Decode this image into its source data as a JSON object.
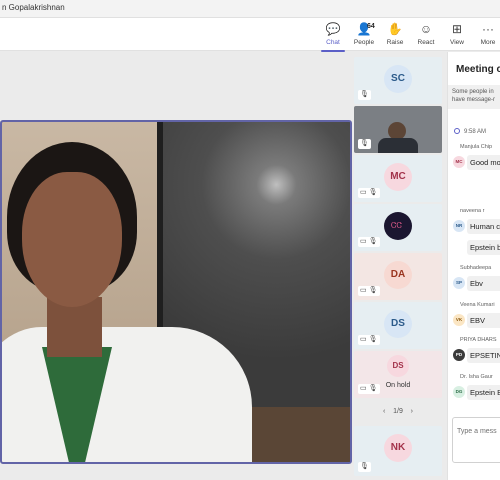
{
  "window": {
    "title": "n Gopalakrishnan"
  },
  "toolbar": {
    "buttons": [
      {
        "label": "Chat",
        "icon": "chat-icon",
        "glyph": "💬"
      },
      {
        "label": "People",
        "icon": "people-icon",
        "glyph": "👤",
        "count": "64"
      },
      {
        "label": "Raise",
        "icon": "raise-hand-icon",
        "glyph": "✋"
      },
      {
        "label": "React",
        "icon": "react-icon",
        "glyph": "☺"
      },
      {
        "label": "View",
        "icon": "view-icon",
        "glyph": "⊞"
      },
      {
        "label": "More",
        "icon": "more-icon",
        "glyph": "···"
      }
    ]
  },
  "thumbnails": [
    {
      "initials": "SC",
      "color": "#d8e6f5",
      "text_color": "#2b5a8a"
    },
    {
      "initials": "",
      "video": true
    },
    {
      "initials": "MC",
      "color": "#f7d8df",
      "text_color": "#a3334b"
    },
    {
      "initials": "",
      "logo": true
    },
    {
      "initials": "DA",
      "color": "#f7d9d2",
      "text_color": "#9a3520"
    },
    {
      "initials": "DS",
      "color": "#d8e6f5",
      "text_color": "#2b5a8a"
    },
    {
      "initials": "DS",
      "color": "#f7d8df",
      "text_color": "#a3334b",
      "status": "On hold"
    },
    {
      "initials": "NK",
      "color": "#f7d8df",
      "text_color": "#a3334b"
    }
  ],
  "pager": {
    "text": "1/9",
    "prev": "‹",
    "next": "›"
  },
  "chat": {
    "title": "Meeting c",
    "banner": [
      "Some people in",
      "have message-r"
    ],
    "time": "9:58 AM",
    "messages": [
      {
        "sender": "Manjula Chip",
        "initials": "MC",
        "text": "Good mo",
        "color": "#f7d8df",
        "tc": "#a3334b"
      },
      {
        "sender": "naveena r",
        "initials": "NR",
        "text": "Human c",
        "color": "#d8e6f5",
        "tc": "#2b5a8a"
      },
      {
        "sender": "",
        "initials": "",
        "text": "Epstein b"
      },
      {
        "sender": "Subhadeepa",
        "initials": "SP",
        "text": "Ebv",
        "color": "#d8e6f5",
        "tc": "#2b5a8a"
      },
      {
        "sender": "Veena Kumari",
        "initials": "VK",
        "text": "EBV",
        "color": "#fbe6c4",
        "tc": "#8a5a10"
      },
      {
        "sender": "PRIYA DHARS",
        "initials": "PD",
        "text": "EPSETIN",
        "color": "#3a3a3a",
        "tc": "#ffffff"
      },
      {
        "sender": "Dr. Isha Gaur",
        "initials": "DG",
        "text": "Epstein B",
        "color": "#d8efe2",
        "tc": "#2a6b45"
      }
    ],
    "compose_placeholder": "Type a mess"
  },
  "colors": {
    "accent": "#5b5fc7",
    "speaker_border": "#6264a7"
  }
}
